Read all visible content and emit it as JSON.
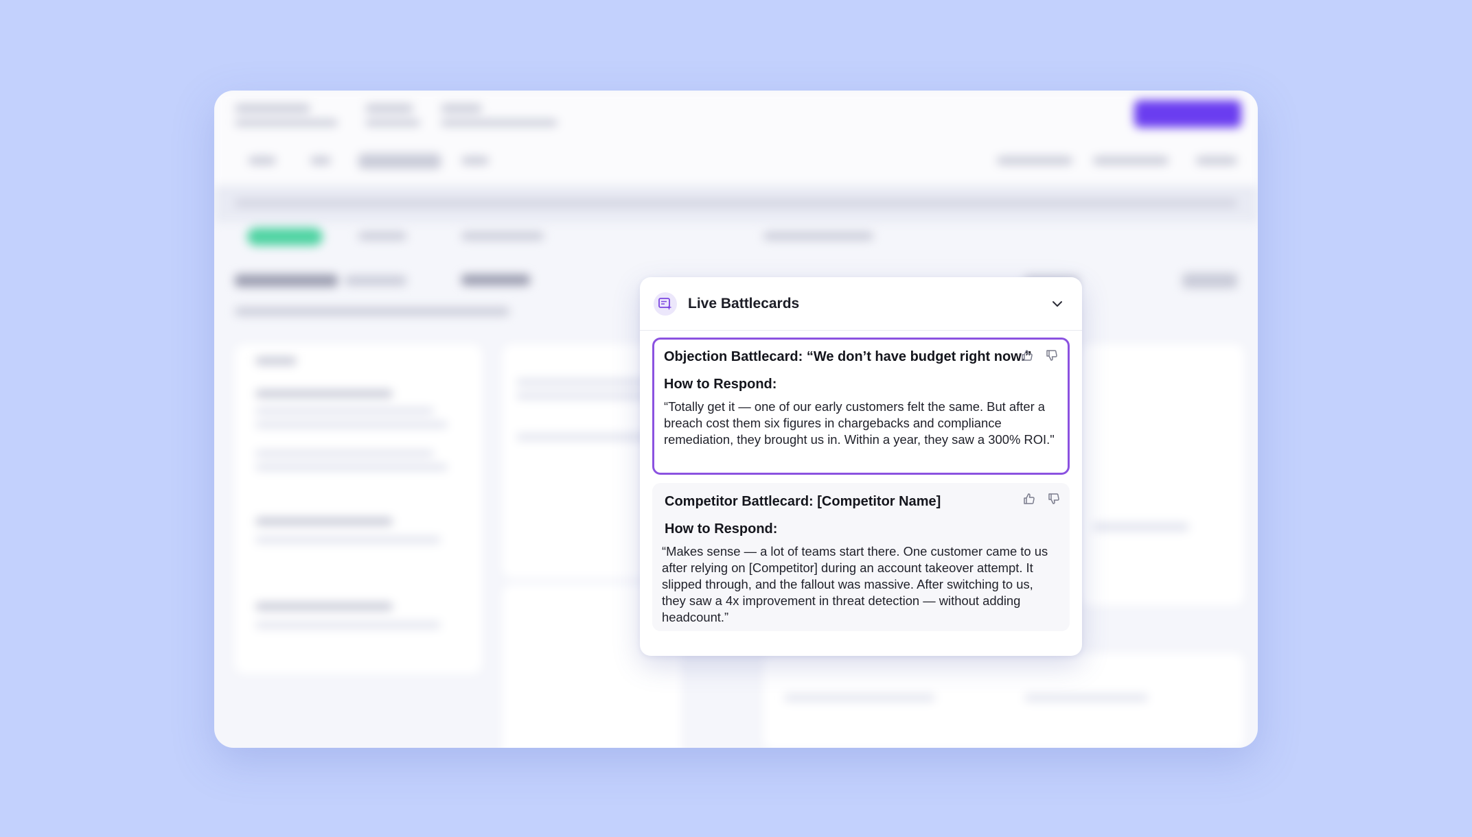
{
  "panel": {
    "title": "Live Battlecards",
    "logo_icon": "battlecard-sparkle-icon",
    "collapse_icon": "chevron-down-icon"
  },
  "battlecards": [
    {
      "title": "Objection Battlecard: “We don’t have budget right now.”",
      "subtitle": "How to Respond:",
      "response": "“Totally get it — one of our early customers felt the same. But after a breach cost them six figures in chargebacks and compliance remediation, they brought us in. Within a year, they saw a 300% ROI.\"",
      "active": true
    },
    {
      "title": "Competitor Battlecard: [Competitor Name]",
      "subtitle": "How to Respond:",
      "response": "“Makes sense — a lot of teams start there. One customer came to us after relying on [Competitor] during an account takeover attempt. It slipped through, and the fallout was massive. After switching to us, they saw a 4x improvement in threat detection — without adding headcount.”",
      "active": false
    }
  ],
  "colors": {
    "background": "#c3d1fd",
    "accent": "#8b52e0",
    "icon": "#7a7c8c"
  }
}
